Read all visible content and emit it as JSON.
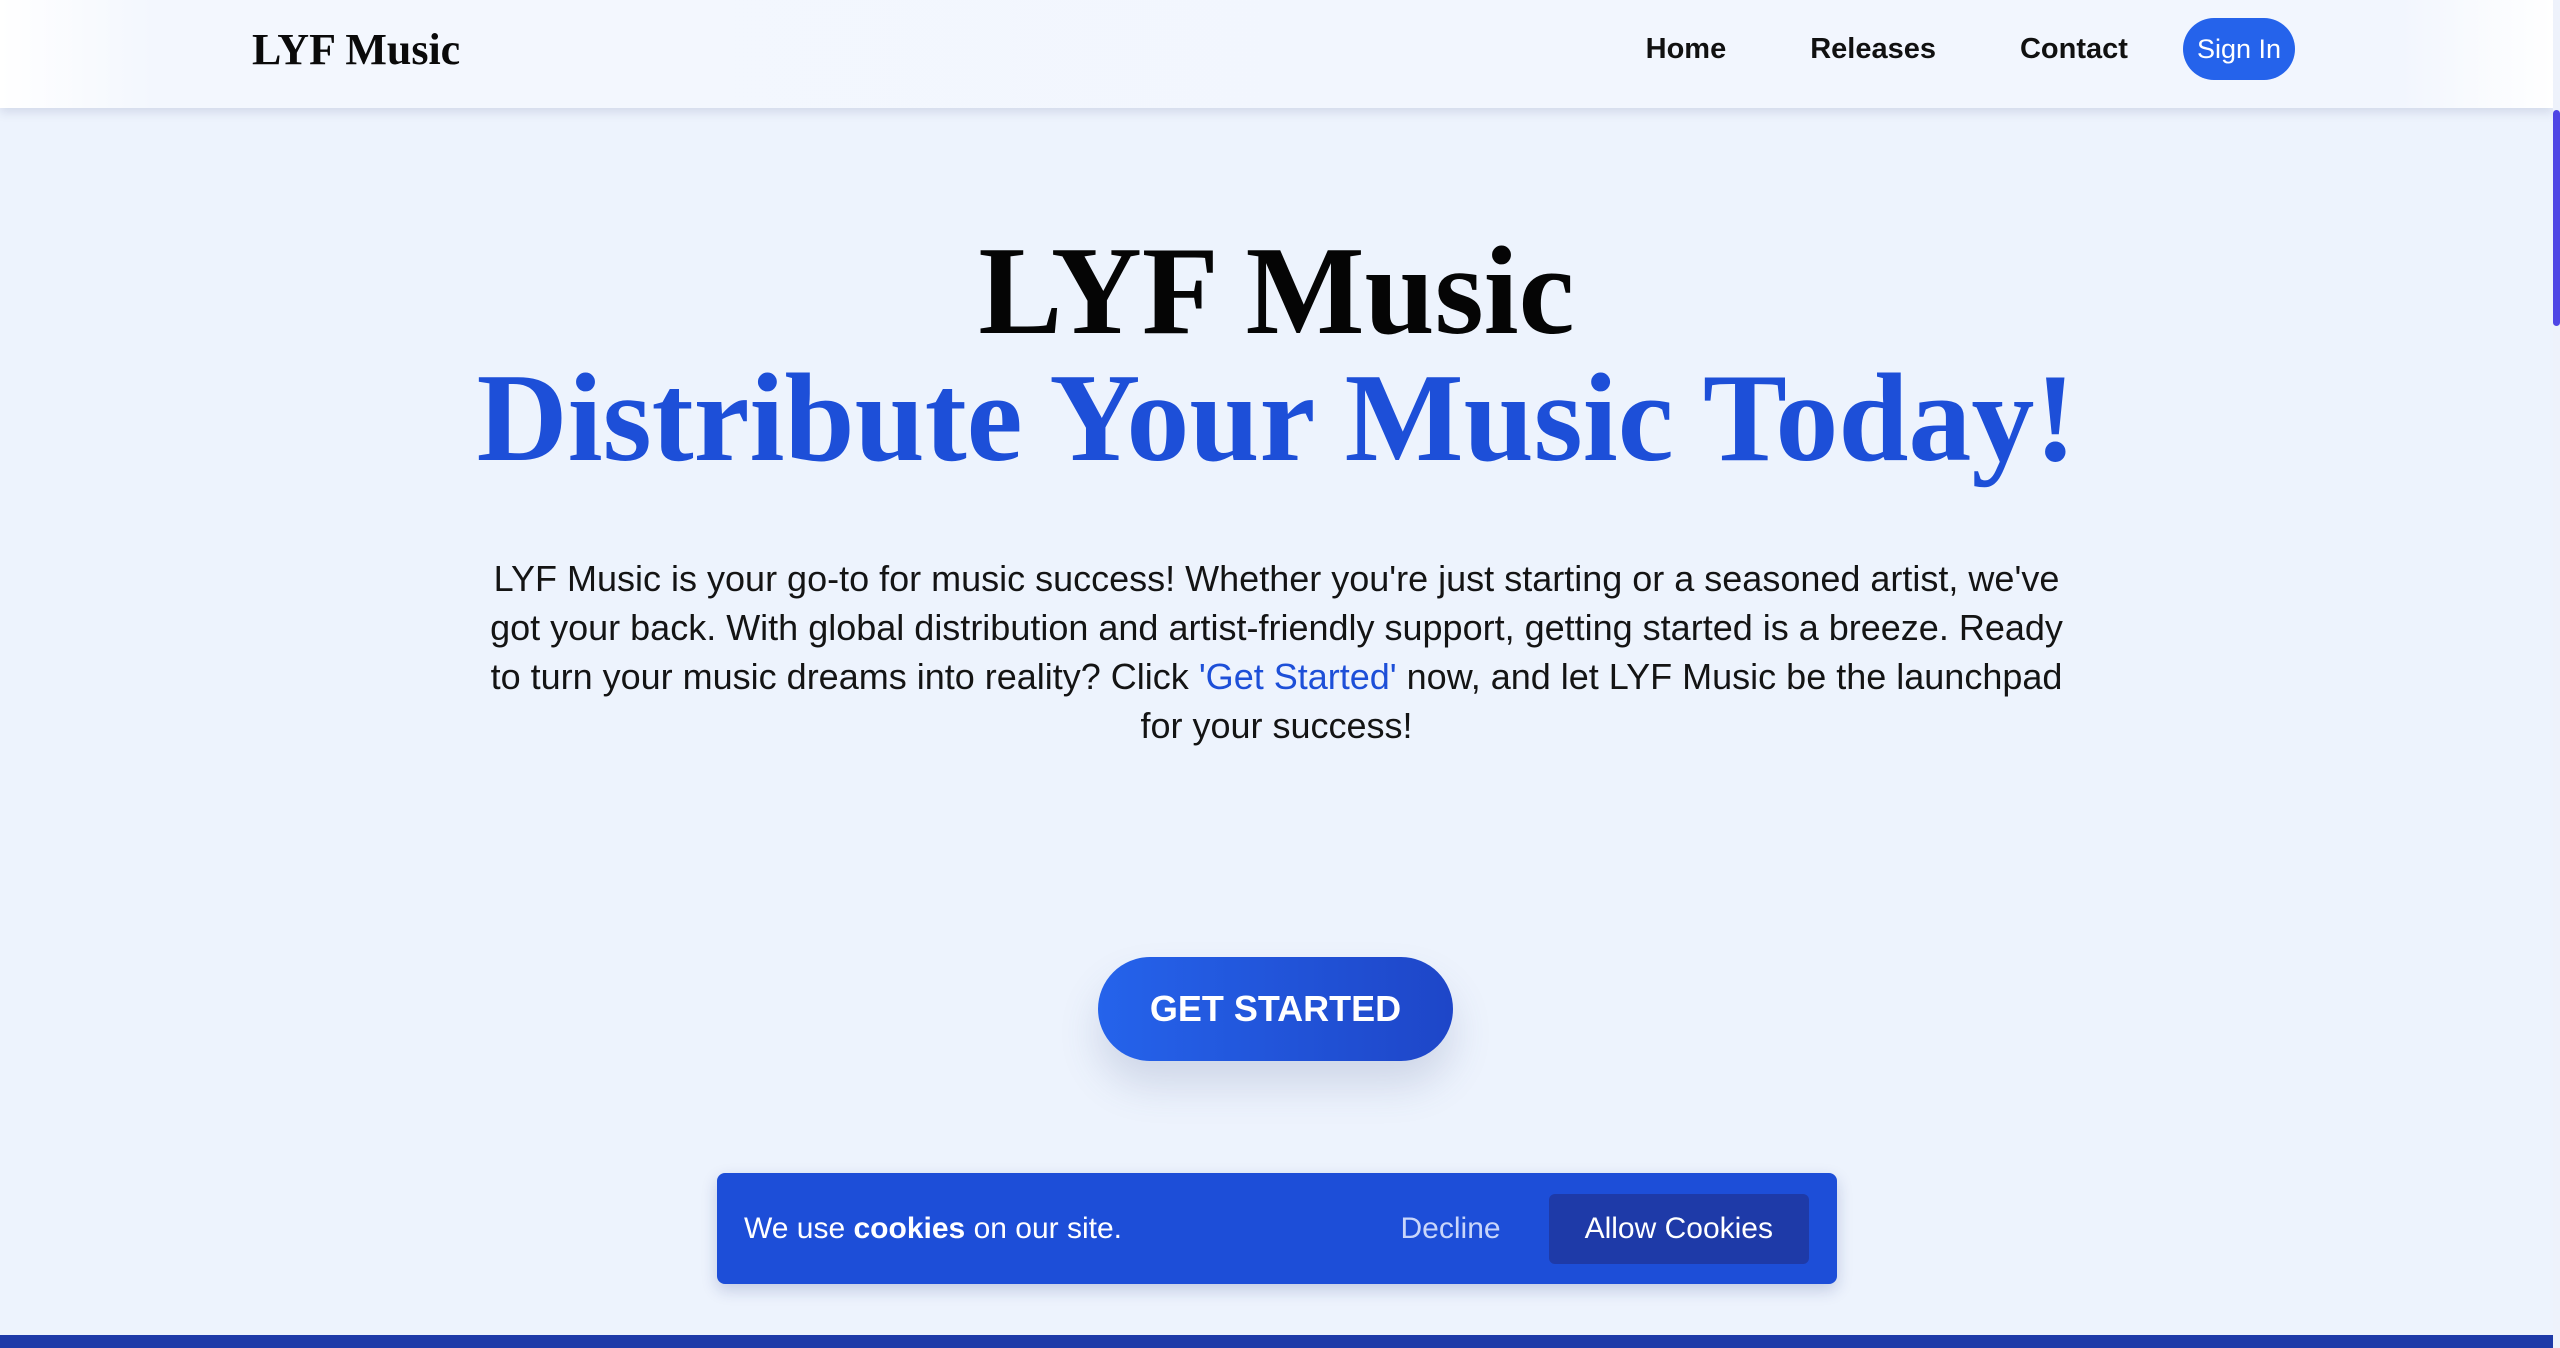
{
  "header": {
    "brand": "LYF Music",
    "nav": {
      "home": "Home",
      "releases": "Releases",
      "contact": "Contact",
      "sign_in": "Sign In"
    }
  },
  "hero": {
    "title": "LYF Music",
    "subtitle": "Distribute Your Music Today!",
    "text_before_link": "LYF Music is your go-to for music success! Whether you're just starting or a seasoned artist, we've got your back. With global distribution and artist-friendly support, getting started is a breeze. Ready to turn your music dreams into reality? Click ",
    "text_link": "'Get Started'",
    "text_after_link": " now, and let LYF Music be the launchpad for your success!",
    "cta_label": "GET STARTED"
  },
  "cookie_banner": {
    "text_prefix": "We use ",
    "text_bold": "cookies",
    "text_suffix": " on our site.",
    "decline_label": "Decline",
    "allow_label": "Allow Cookies"
  },
  "colors": {
    "accent": "#1d4fd8",
    "button": "#2563eb",
    "banner": "#1d4ed8",
    "background": "#edf3fd"
  }
}
